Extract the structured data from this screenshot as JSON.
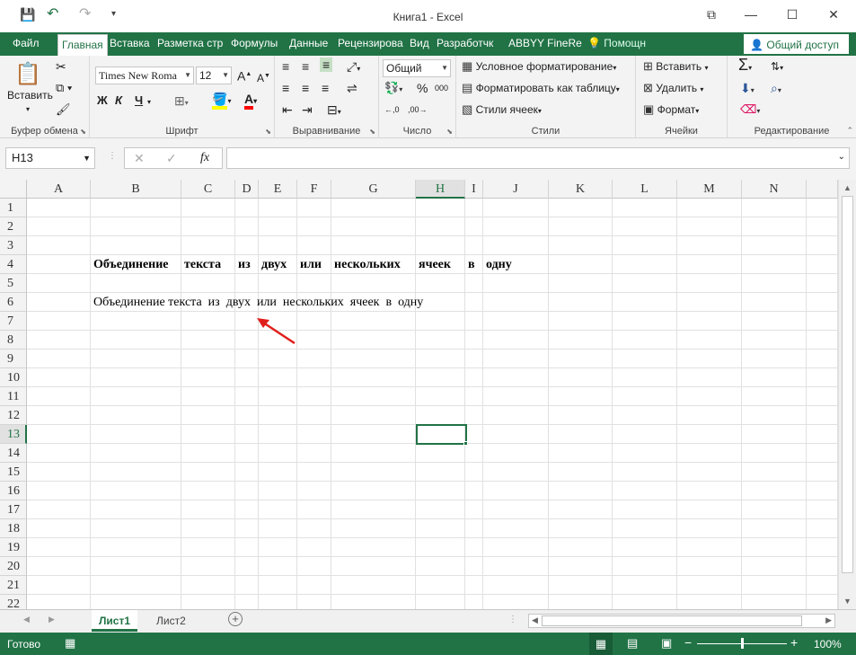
{
  "window": {
    "title": "Книга1 - Excel"
  },
  "quick_access": {
    "save_icon": "💾",
    "undo_icon": "↶",
    "redo_icon": "↷",
    "customize_icon": "▾"
  },
  "window_controls": {
    "ribbon_options": "⧉",
    "minimize": "—",
    "restore": "☐",
    "close": "✕"
  },
  "tabs": [
    "Файл",
    "Главная",
    "Вставка",
    "Разметка стр",
    "Формулы",
    "Данные",
    "Рецензирова",
    "Вид",
    "Разработчк",
    "ABBYY FineRe"
  ],
  "tell_me": "Помощн",
  "share": "Общий доступ",
  "ribbon": {
    "clipboard": {
      "label": "Буфер обмена",
      "paste": "Вставить"
    },
    "font": {
      "label": "Шрифт",
      "font_name": "Times New Roma",
      "font_size": "12",
      "bold": "Ж",
      "italic": "К",
      "underline": "Ч"
    },
    "alignment": {
      "label": "Выравнивание"
    },
    "number": {
      "label": "Число",
      "format": "Общий",
      "percent": "%",
      "thousands": "000"
    },
    "styles": {
      "label": "Стили",
      "conditional": "Условное форматирование",
      "as_table": "Форматировать как таблицу",
      "cell_styles": "Стили ячеек"
    },
    "cells": {
      "label": "Ячейки",
      "insert": "Вставить",
      "delete": "Удалить",
      "format": "Формат"
    },
    "editing": {
      "label": "Редактирование"
    }
  },
  "formula_bar": {
    "name_box": "H13",
    "cancel": "✕",
    "enter": "✓",
    "fx": "fx",
    "formula": ""
  },
  "columns": [
    "A",
    "B",
    "C",
    "D",
    "E",
    "F",
    "G",
    "H",
    "I",
    "J",
    "K",
    "L",
    "M",
    "N"
  ],
  "rows": [
    "1",
    "2",
    "3",
    "4",
    "5",
    "6",
    "7",
    "8",
    "9",
    "10",
    "11",
    "12",
    "13",
    "14",
    "15",
    "16",
    "17",
    "18",
    "19",
    "20",
    "21",
    "22"
  ],
  "selected": {
    "column": "H",
    "row": "13"
  },
  "cells": {
    "row4": [
      "Объединение",
      "текста",
      "из",
      "двух",
      "или",
      "нескольких",
      "ячеек",
      "в",
      "одну"
    ],
    "b6": "Объединение текста  из  двух  или  нескольких  ячеек  в  одну"
  },
  "sheets": [
    "Лист1",
    "Лист2"
  ],
  "status": {
    "ready": "Готово",
    "zoom": "100%",
    "minus": "−",
    "plus": "+"
  },
  "colors": {
    "accent": "#217346",
    "arrow": "#e0201c"
  }
}
